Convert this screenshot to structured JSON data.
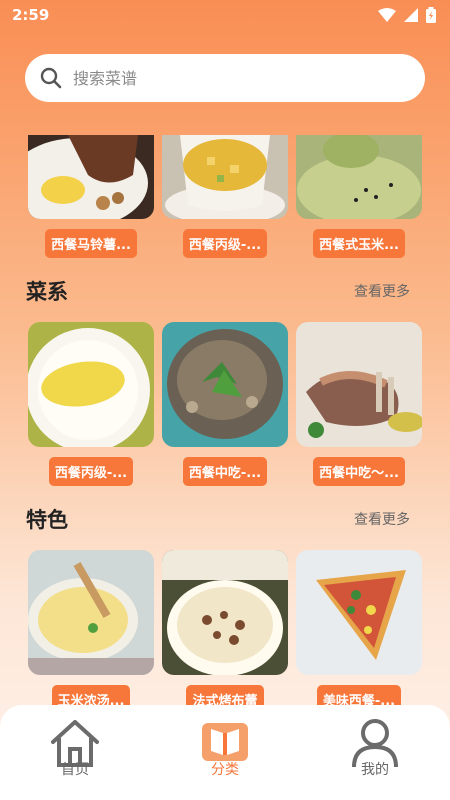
{
  "status_bar": {
    "time": "2:59"
  },
  "search": {
    "placeholder": "搜索菜谱"
  },
  "top_row": [
    "西餐马铃薯...",
    "西餐丙级-...",
    "西餐式玉米..."
  ],
  "sections": [
    {
      "title": "菜系",
      "more": "查看更多",
      "items": [
        "西餐丙级-...",
        "西餐中吃-...",
        "西餐中吃～..."
      ]
    },
    {
      "title": "特色",
      "more": "查看更多",
      "items": [
        "玉米浓汤...",
        "法式烤布蕾",
        "美味西餐-..."
      ]
    }
  ],
  "bottom_nav": [
    {
      "label": "首页",
      "icon": "home-icon",
      "active": false
    },
    {
      "label": "分类",
      "icon": "book-icon",
      "active": true
    },
    {
      "label": "我的",
      "icon": "person-icon",
      "active": false
    }
  ],
  "colors": {
    "accent": "#f7773a",
    "header_top": "#f98e54"
  }
}
